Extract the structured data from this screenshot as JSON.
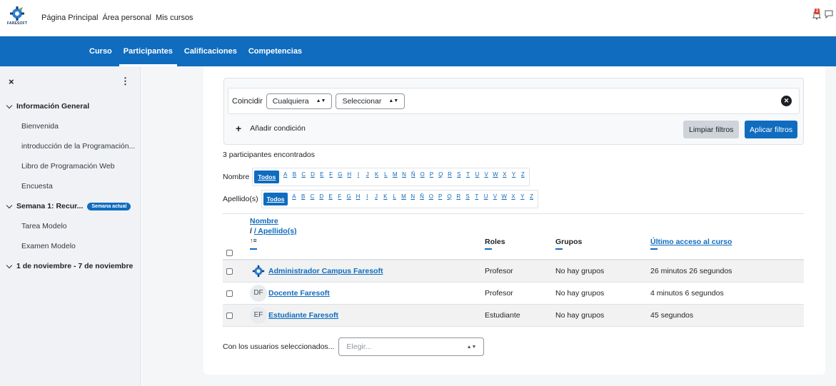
{
  "topbar": {
    "logo_text": "FARESOFT",
    "nav": [
      "Página Principal",
      "Área personal",
      "Mis cursos"
    ],
    "notification_count": "2"
  },
  "secondary_nav": {
    "tabs": [
      "Curso",
      "Participantes",
      "Calificaciones",
      "Competencias"
    ],
    "active": "Participantes"
  },
  "drawer": {
    "close": "×",
    "menu": "⋮",
    "sections": [
      {
        "title": "Información General",
        "items": [
          "Bienvenida",
          "introducción de la Programación...",
          "Libro de Programación Web",
          "Encuesta"
        ]
      },
      {
        "title": "Semana 1: Recur...",
        "badge": "Semana actual",
        "items": [
          "Tarea Modelo",
          "Examen Modelo"
        ]
      },
      {
        "title": "1 de noviembre - 7 de noviembre",
        "items": []
      }
    ]
  },
  "filters": {
    "match_label": "Coincidir",
    "match_value": "Cualquiera",
    "type_value": "Seleccionar",
    "add_condition": "Añadir condición",
    "clear": "Limpiar filtros",
    "apply": "Aplicar filtros"
  },
  "found_text": "3 participantes encontrados",
  "initials": {
    "first_label": "Nombre",
    "last_label": "Apellido(s)",
    "all": "Todos",
    "letters": [
      "A",
      "B",
      "C",
      "D",
      "E",
      "F",
      "G",
      "H",
      "I",
      "J",
      "K",
      "L",
      "M",
      "N",
      "Ñ",
      "O",
      "P",
      "Q",
      "R",
      "S",
      "T",
      "U",
      "V",
      "W",
      "X",
      "Y",
      "Z"
    ]
  },
  "table": {
    "headers": {
      "name": "Nombre",
      "surname": "/ Apellido(s)",
      "sort_icon": "↑≡",
      "roles": "Roles",
      "groups": "Grupos",
      "last_access": "Último acceso al curso"
    },
    "rows": [
      {
        "initials": "",
        "name": "Administrador Campus Faresoft",
        "role": "Profesor",
        "groups": "No hay grupos",
        "last": "26 minutos 26 segundos"
      },
      {
        "initials": "DF",
        "name": "Docente Faresoft",
        "role": "Profesor",
        "groups": "No hay grupos",
        "last": "4 minutos 6 segundos"
      },
      {
        "initials": "EF",
        "name": "Estudiante Faresoft",
        "role": "Estudiante",
        "groups": "No hay grupos",
        "last": "45 segundos"
      }
    ]
  },
  "bulk": {
    "label": "Con los usuarios seleccionados...",
    "placeholder": "Elegir..."
  },
  "colors": {
    "primary": "#0f6cbf",
    "badge": "#e03a2e"
  }
}
